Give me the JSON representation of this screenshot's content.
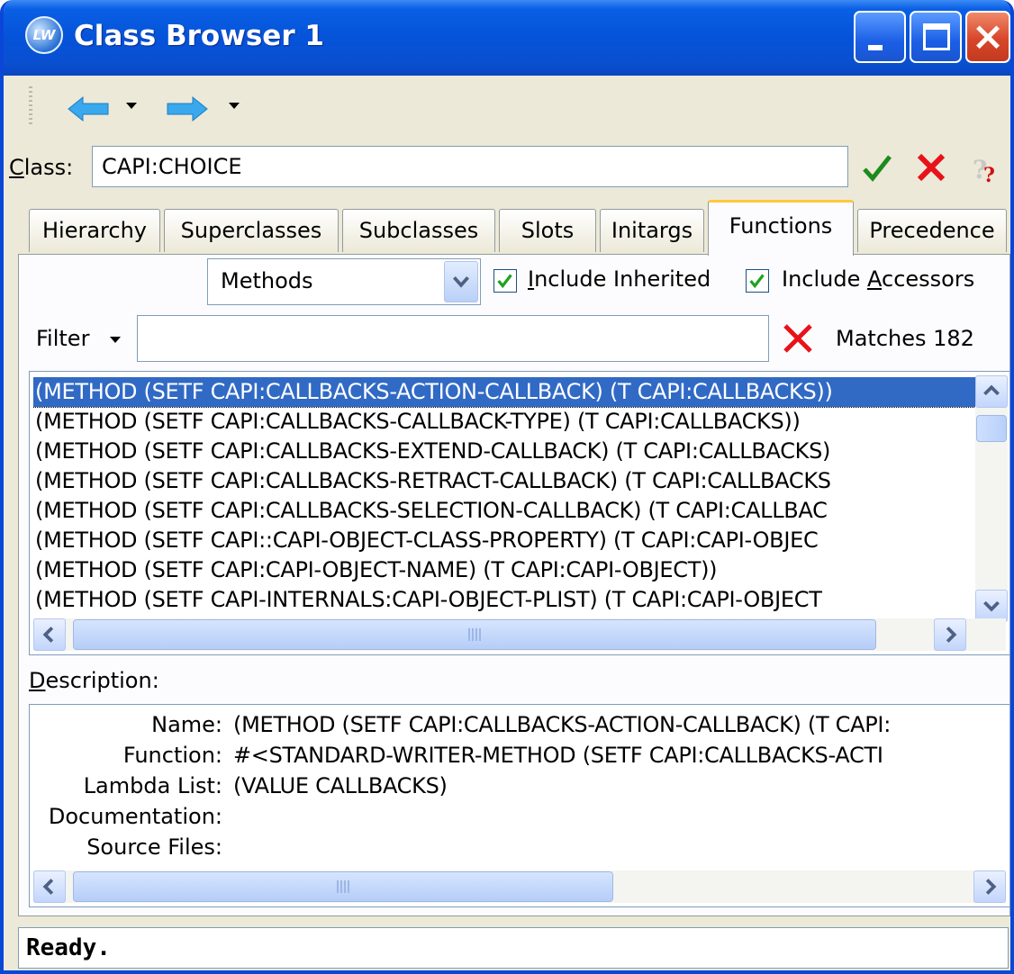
{
  "window": {
    "title": "Class Browser 1",
    "app_icon_text": "LW"
  },
  "class_row": {
    "label_first": "C",
    "label_rest": "lass:",
    "value": "CAPI:CHOICE"
  },
  "tabs": [
    {
      "label": "Hierarchy"
    },
    {
      "label": "Superclasses"
    },
    {
      "label": "Subclasses"
    },
    {
      "label": "Slots"
    },
    {
      "label": "Initargs"
    },
    {
      "label": "Functions",
      "active": true
    },
    {
      "label": "Precedence"
    }
  ],
  "functions": {
    "kind_select": "Methods",
    "include_inherited": {
      "label_first": "I",
      "label_rest": "nclude Inherited",
      "checked": true
    },
    "include_accessors": {
      "label_pre": "Include ",
      "label_u": "A",
      "label_rest": "ccessors",
      "checked": true
    },
    "filter_label": "Filter",
    "filter_value": "",
    "matches": "Matches 182",
    "items": [
      "(METHOD (SETF CAPI:CALLBACKS-ACTION-CALLBACK) (T CAPI:CALLBACKS))",
      "(METHOD (SETF CAPI:CALLBACKS-CALLBACK-TYPE) (T CAPI:CALLBACKS))",
      "(METHOD (SETF CAPI:CALLBACKS-EXTEND-CALLBACK) (T CAPI:CALLBACKS)",
      "(METHOD (SETF CAPI:CALLBACKS-RETRACT-CALLBACK) (T CAPI:CALLBACKS",
      "(METHOD (SETF CAPI:CALLBACKS-SELECTION-CALLBACK) (T CAPI:CALLBAC",
      "(METHOD (SETF CAPI::CAPI-OBJECT-CLASS-PROPERTY) (T CAPI:CAPI-OBJEC",
      "(METHOD (SETF CAPI:CAPI-OBJECT-NAME) (T CAPI:CAPI-OBJECT))",
      "(METHOD (SETF CAPI-INTERNALS:CAPI-OBJECT-PLIST) (T CAPI:CAPI-OBJECT"
    ],
    "selected_index": 0
  },
  "description": {
    "label_first": "D",
    "label_rest": "escription:",
    "rows": [
      {
        "key": "Name:",
        "value": "(METHOD (SETF CAPI:CALLBACKS-ACTION-CALLBACK) (T CAPI:"
      },
      {
        "key": "Function:",
        "value": "#<STANDARD-WRITER-METHOD (SETF CAPI:CALLBACKS-ACTI"
      },
      {
        "key": "Lambda List:",
        "value": "(VALUE CALLBACKS)"
      },
      {
        "key": "Documentation:",
        "value": ""
      },
      {
        "key": "Source Files:",
        "value": ""
      }
    ]
  },
  "status": "Ready.",
  "colors": {
    "titlebar": "#0553d9",
    "selection": "#316ac5",
    "tab_highlight": "#ffc83c",
    "window_bg": "#ece9d8"
  },
  "icons": {
    "back": "back-arrow-icon",
    "forward": "forward-arrow-icon",
    "ok": "checkmark-icon",
    "cancel": "red-x-icon",
    "help": "help-icon"
  }
}
